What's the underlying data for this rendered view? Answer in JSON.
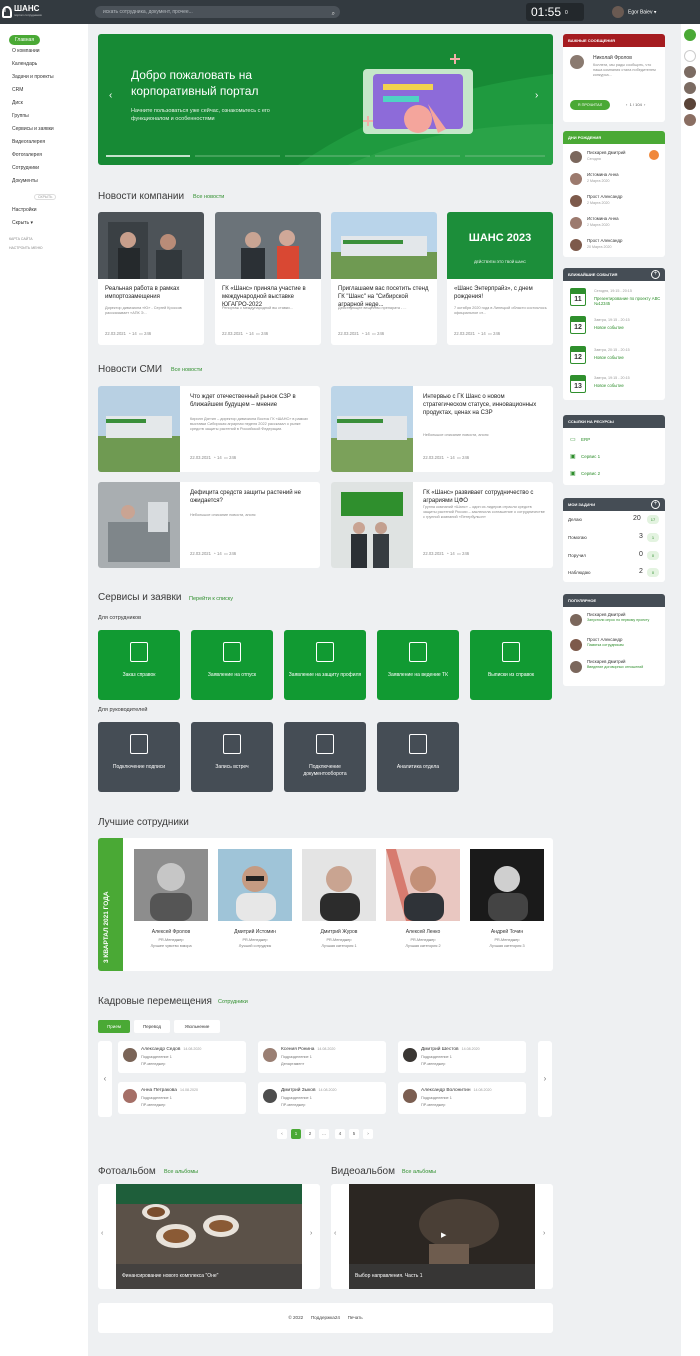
{
  "topbar": {
    "logo": "ШАНС",
    "logo_sub": "портал сотрудников",
    "search_placeholder": "искать сотрудника, документ, прочее...",
    "clock": "01:55",
    "clock_badge": "0",
    "user": "Egor Baiev"
  },
  "leftnav": {
    "items": [
      "Главная",
      "О компании",
      "Календарь",
      "Задачи и проекты",
      "CRM",
      "Диск",
      "Группы",
      "Сервисы и заявки",
      "Видеогалерея",
      "Фотогалерея",
      "Сотрудники",
      "Документы"
    ],
    "divider": "СКРЫТЬ",
    "extra": [
      "Настройки",
      "Скрыть ▾"
    ],
    "footer": [
      "КАРТА САЙТА",
      "НАСТРОИТЬ МЕНЮ"
    ]
  },
  "hero": {
    "title": "Добро пожаловать на корпоративный портал",
    "subtitle": "Начните пользоваться уже сейчас, ознакомьтесь с его функционалом и особенностями"
  },
  "company_news": {
    "title": "Новости компании",
    "link": "Все новости",
    "items": [
      {
        "title": "Реальная работа в рамках импортозамещения",
        "desc": "Директор дивизиона «Ю» - Сергей Кроссов рассказывает «АПК Э...",
        "date": "22.03.2021",
        "views": "14",
        "comments": "246"
      },
      {
        "title": "ГК «Шанс» приняла участие в международной выставке ЮГАГРО-2022",
        "desc": "Репортаж с международной вы ставки...",
        "date": "22.03.2021",
        "views": "14",
        "comments": "246"
      },
      {
        "title": "Приглашаем вас посетить стенд ГК \"Шанс\" на \"Сибирской аграрной неде...",
        "desc": "Действующее вещество препарата - ...",
        "date": "22.03.2021",
        "views": "14",
        "comments": "246"
      },
      {
        "title": "«Шанс Энтерпрайз», с днем рождения!",
        "desc": "7 октября 2020 года в Липецкой области состоялось официальное от...",
        "date": "22.03.2021",
        "views": "14",
        "comments": "246"
      }
    ],
    "badge_text": "ШАНС 2023",
    "badge_sub": "ДЕЙСТВУЕМ ЭТО ТВОЙ ШАНС"
  },
  "media_news": {
    "title": "Новости СМИ",
    "link": "Все новости",
    "items": [
      {
        "title": "Что ждет отечественный рынок СЗР в ближайшем будущем – мнение",
        "desc": "Кирилл Дягтин – директор дивизиона Восток ГК «ШАНС» в рамках выставки Сибирская аграрная неделя 2022 рассказал о рынке средств защиты растений в Российской Федерации.",
        "date": "22.03.2021",
        "views": "14",
        "comments": "246"
      },
      {
        "title": "Интервью с ГК Шанс о новом стратегическом статусе, инновационных продуктах, ценах на СЗР",
        "desc": "Небольшое описание новости, анонс",
        "date": "22.03.2021",
        "views": "14",
        "comments": "246"
      },
      {
        "title": "Дефицита средств защиты растений не ожидается?",
        "desc": "Небольшое описание новости, анонс",
        "date": "22.03.2021",
        "views": "14",
        "comments": "246"
      },
      {
        "title": "ГК «Шанс» развивает сотрудничество с аграриями ЦФО",
        "desc": "Группа компаний «Шанс» – один из лидеров отрасли средств защиты растений России – заключила соглашение о сотрудничестве с группой компаний «Петербульон»",
        "date": "22.03.2021",
        "views": "14",
        "comments": "246"
      }
    ]
  },
  "services": {
    "title": "Сервисы и заявки",
    "link": "Перейти к списку",
    "group1": "Для сотрудников",
    "group2": "Для руководителей",
    "employee_items": [
      "Заказ справок",
      "Заявление на отпуск",
      "Заявление на защиту профиля",
      "Заявление на ведение ТК",
      "Выписки из справок"
    ],
    "manager_items": [
      "Подключение подписи",
      "Запись встреч",
      "Подключение документооборота",
      "Аналитика отдела"
    ]
  },
  "best": {
    "title": "Лучшие сотрудники",
    "quarter": "3 КВАРТАЛ 2021 ГОДА",
    "people": [
      {
        "name": "Алексей Фролов",
        "role": "PR-Менеджер",
        "dept": "Лучшее чувство юмора"
      },
      {
        "name": "Дмитрий Истомин",
        "role": "PR-Менеджер",
        "dept": "Лучший сотрудник"
      },
      {
        "name": "Дмитрий Журов",
        "role": "PR-Менеджер",
        "dept": "Лучшая категория 1"
      },
      {
        "name": "Алексей Ленко",
        "role": "PR-Менеджер",
        "dept": "Лучшая категория 2"
      },
      {
        "name": "Андрей Точин",
        "role": "PR-Менеджер",
        "dept": "Лучшая категория 3"
      }
    ]
  },
  "moves": {
    "title": "Кадровые перемещения",
    "link": "Сотрудники",
    "tabs": [
      "Прием",
      "Перевод",
      "Увольнение"
    ],
    "items": [
      {
        "name": "Александр Седов",
        "date": "14.08.2020",
        "sub1": "Подразделение 1",
        "sub2": "ПР-менеджер"
      },
      {
        "name": "Ксения Ронина",
        "date": "14.08.2020",
        "sub1": "Подразделение 1",
        "sub2": "Департамент"
      },
      {
        "name": "Дмитрий Шестов",
        "date": "14.08.2020",
        "sub1": "Подразделение 1",
        "sub2": "ПР-менеджер"
      },
      {
        "name": "Анна Петракова",
        "date": "14.08.2020",
        "sub1": "Подразделение 1",
        "sub2": "ПР-менеджер"
      },
      {
        "name": "Дмитрий Зыков",
        "date": "14.08.2020",
        "sub1": "Подразделение 1",
        "sub2": "ПР-менеджер"
      },
      {
        "name": "Александр Волонитин",
        "date": "14.08.2020",
        "sub1": "Подразделение 1",
        "sub2": "ПР-менеджер"
      }
    ],
    "pages": [
      "‹",
      "1",
      "2",
      "...",
      "4",
      "5",
      "›"
    ]
  },
  "photo": {
    "title": "Фотоальбом",
    "link": "Все альбомы",
    "caption": "Финансирование нового комплекса \"Оне\""
  },
  "video": {
    "title": "Видеоальбом",
    "link": "Все альбомы",
    "caption": "Выбор направления. Часть 1"
  },
  "footer": {
    "year": "© 2022",
    "support": "Поддержка24",
    "print": "Печать"
  },
  "widgets": {
    "important": {
      "title": "ВАЖНЫЕ СООБЩЕНИЯ",
      "name": "Николай Фролов",
      "text": "Коллеги, мы рады сообщить, что наша компания стала победителем конкурса...",
      "button": "Я ПРОЧИТАЛ",
      "pager": "1 / 104"
    },
    "birthdays": {
      "title": "ДНИ РОЖДЕНИЯ",
      "items": [
        {
          "n": "Пискарев Дмитрий",
          "d": "Сегодня"
        },
        {
          "n": "Истомина Анна",
          "d": "2 Марта 2020"
        },
        {
          "n": "Прост Александр",
          "d": "2 Марта 2020"
        },
        {
          "n": "Истомина Анна",
          "d": "2 Марта 2020"
        },
        {
          "n": "Прост Александр",
          "d": "20 Марта 2020"
        }
      ]
    },
    "events": {
      "title": "БЛИЖАЙШИЕ СОБЫТИЯ",
      "items": [
        {
          "dow": "ПН",
          "day": "11",
          "time": "Сегодня, 19:15 - 20:15",
          "label": "Презентирование по проекту АВС №12345"
        },
        {
          "dow": "ВТ",
          "day": "12",
          "time": "Завтра, 19:15 - 20:15",
          "label": "Новое событие"
        },
        {
          "dow": "ВТ",
          "day": "12",
          "time": "Завтра, 20:15 - 20:15",
          "label": "Новое событие"
        },
        {
          "dow": "СР",
          "day": "13",
          "time": "Завтра, 19:15 - 20:15",
          "label": "Новое событие"
        }
      ]
    },
    "resources": {
      "title": "ССЫЛКИ НА РЕСУРСЫ",
      "items": [
        "ERP",
        "Сервис 1",
        "Сервис 2"
      ]
    },
    "tasks": {
      "title": "МОИ ЗАДАЧИ",
      "items": [
        {
          "label": "Делаю",
          "count": "20",
          "badge": "17"
        },
        {
          "label": "Помогаю",
          "count": "3",
          "badge": "1"
        },
        {
          "label": "Поручил",
          "count": "0",
          "badge": "0"
        },
        {
          "label": "Наблюдаю",
          "count": "2",
          "badge": "0"
        }
      ]
    },
    "popular": {
      "title": "ПОПУЛЯРНОЕ",
      "items": [
        {
          "n": "Пискарев Дмитрий",
          "l": "Запустили опрос по первому проекту"
        },
        {
          "n": "Прост Александр",
          "l": "Памятка сотрудникам"
        },
        {
          "n": "Пискарев Дмитрий",
          "l": "Введение договорных отношений"
        }
      ]
    }
  },
  "colors": {
    "brand": "#2f8f2d",
    "hero": "#178a35",
    "dark": "#333a40",
    "service_grey": "#454d55",
    "important_red": "#a51c20"
  }
}
